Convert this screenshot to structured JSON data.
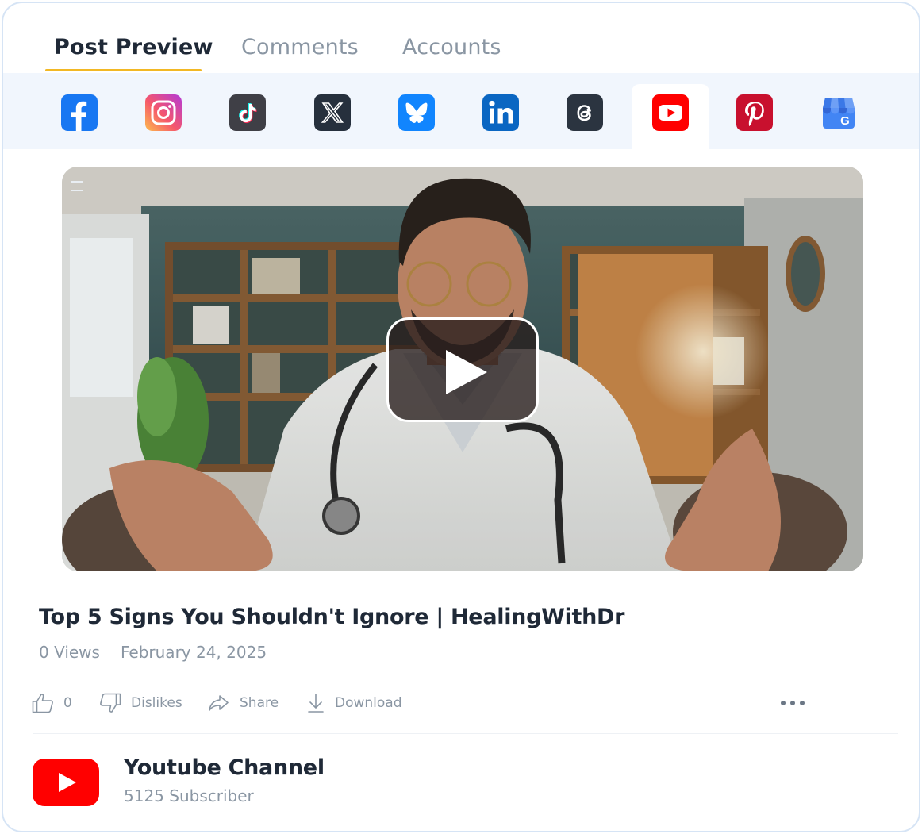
{
  "tabs": [
    {
      "label": "Post Preview",
      "active": true
    },
    {
      "label": "Comments",
      "active": false
    },
    {
      "label": "Accounts",
      "active": false
    }
  ],
  "networks": [
    {
      "name": "facebook-icon",
      "color": "#1877f2"
    },
    {
      "name": "instagram-icon",
      "color": "#e4405f"
    },
    {
      "name": "tiktok-icon",
      "color": "#3f3f46"
    },
    {
      "name": "x-icon",
      "color": "#26303d"
    },
    {
      "name": "bluesky-icon",
      "color": "#1185fe"
    },
    {
      "name": "linkedin-icon",
      "color": "#0a66c2"
    },
    {
      "name": "threads-icon",
      "color": "#2b3440"
    },
    {
      "name": "youtube-icon",
      "color": "#ff0000",
      "selected": true
    },
    {
      "name": "pinterest-icon",
      "color": "#c8102e"
    },
    {
      "name": "google-business-icon",
      "color": "#4285f4"
    }
  ],
  "video": {
    "title": "Top 5 Signs You Shouldn't Ignore | HealingWithDr",
    "views": "0 Views",
    "date": "February 24, 2025"
  },
  "actions": {
    "likes": "0",
    "dislikes": "Dislikes",
    "share": "Share",
    "download": "Download"
  },
  "channel": {
    "name": "Youtube Channel",
    "subscribers": "5125 Subscriber"
  },
  "colors": {
    "accent": "#f2b824",
    "strip_bg": "#f1f6fd",
    "youtube_red": "#ff0000"
  }
}
